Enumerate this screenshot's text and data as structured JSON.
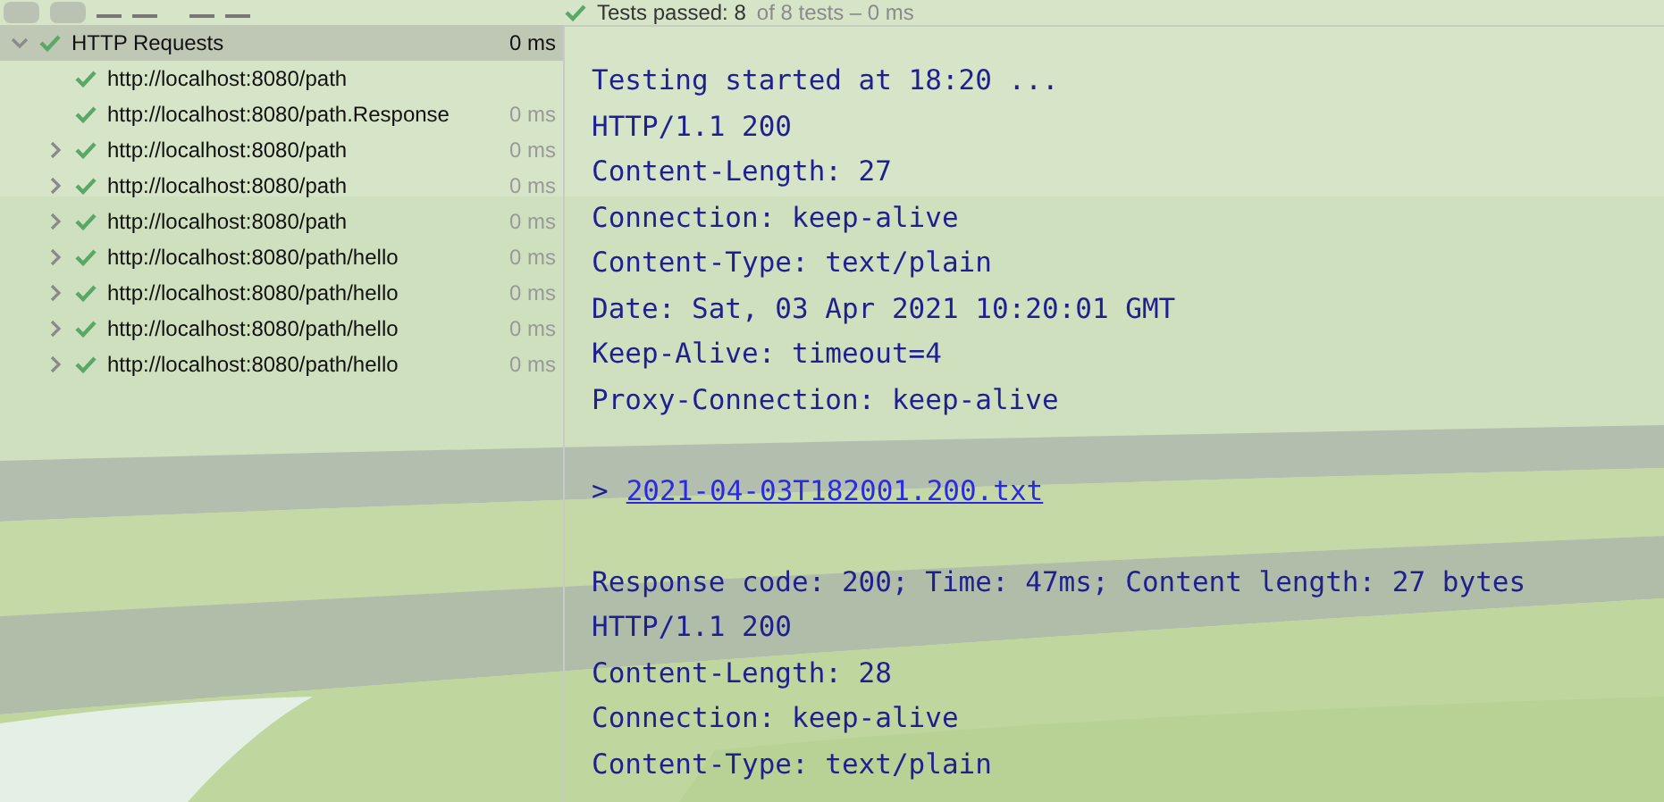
{
  "toolbar": {
    "status": "Tests passed: 8",
    "detail": "of 8 tests – 0 ms"
  },
  "tree": {
    "label": "HTTP Requests",
    "time": "0 ms",
    "expanded": true,
    "selected": true,
    "passed": true,
    "children": [
      {
        "label": "http://localhost:8080/path",
        "passed": true,
        "expandable": false
      },
      {
        "label": "http://localhost:8080/path.Response",
        "time": "0 ms",
        "passed": true,
        "expandable": false
      },
      {
        "label": "http://localhost:8080/path",
        "time": "0 ms",
        "passed": true,
        "expandable": true
      },
      {
        "label": "http://localhost:8080/path",
        "time": "0 ms",
        "passed": true,
        "expandable": true
      },
      {
        "label": "http://localhost:8080/path",
        "time": "0 ms",
        "passed": true,
        "expandable": true
      },
      {
        "label": "http://localhost:8080/path/hello",
        "time": "0 ms",
        "passed": true,
        "expandable": true
      },
      {
        "label": "http://localhost:8080/path/hello",
        "time": "0 ms",
        "passed": true,
        "expandable": true
      },
      {
        "label": "http://localhost:8080/path/hello",
        "time": "0 ms",
        "passed": true,
        "expandable": true
      },
      {
        "label": "http://localhost:8080/path/hello",
        "time": "0 ms",
        "passed": true,
        "expandable": true
      }
    ]
  },
  "console": {
    "lines": [
      {
        "kind": "text",
        "text": "Testing started at 18:20 ..."
      },
      {
        "kind": "text",
        "text": "HTTP/1.1 200"
      },
      {
        "kind": "text",
        "text": "Content-Length: 27"
      },
      {
        "kind": "text",
        "text": "Connection: keep-alive"
      },
      {
        "kind": "text",
        "text": "Content-Type: text/plain"
      },
      {
        "kind": "text",
        "text": "Date: Sat, 03 Apr 2021 10:20:01 GMT"
      },
      {
        "kind": "text",
        "text": "Keep-Alive: timeout=4"
      },
      {
        "kind": "text",
        "text": "Proxy-Connection: keep-alive"
      },
      {
        "kind": "blank"
      },
      {
        "kind": "link",
        "prefix": ">",
        "text": "2021-04-03T182001.200.txt"
      },
      {
        "kind": "blank"
      },
      {
        "kind": "text",
        "text": "Response code: 200; Time: 47ms; Content length: 27 bytes"
      },
      {
        "kind": "text",
        "text": "HTTP/1.1 200"
      },
      {
        "kind": "text",
        "text": "Content-Length: 28"
      },
      {
        "kind": "text",
        "text": "Connection: keep-alive"
      },
      {
        "kind": "text",
        "text": "Content-Type: text/plain"
      }
    ]
  }
}
